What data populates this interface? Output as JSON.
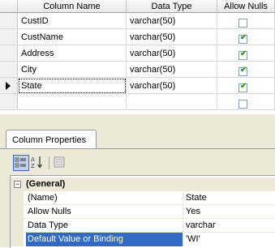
{
  "grid": {
    "headers": {
      "column_name": "Column Name",
      "data_type": "Data Type",
      "allow_nulls": "Allow Nulls"
    },
    "rows": [
      {
        "name": "CustID",
        "type": "varchar(50)",
        "allow_nulls": false
      },
      {
        "name": "CustName",
        "type": "varchar(50)",
        "allow_nulls": true
      },
      {
        "name": "Address",
        "type": "varchar(50)",
        "allow_nulls": true
      },
      {
        "name": "City",
        "type": "varchar(50)",
        "allow_nulls": true
      },
      {
        "name": "State",
        "type": "varchar(50)",
        "allow_nulls": true,
        "selected": true
      },
      {
        "name": "",
        "type": "",
        "allow_nulls": false
      }
    ]
  },
  "panel": {
    "tab_label": "Column Properties",
    "toolbar": {
      "categorized_icon": "categorized-icon",
      "alphabetical_icon": "sort-az-icon",
      "pages_icon": "property-pages-icon"
    },
    "category": "(General)",
    "properties": [
      {
        "name": "(Name)",
        "value": "State"
      },
      {
        "name": "Allow Nulls",
        "value": "Yes"
      },
      {
        "name": "Data Type",
        "value": "varchar"
      },
      {
        "name": "Default Value or Binding",
        "value": "'WI'",
        "selected": true
      }
    ]
  },
  "colors": {
    "selection": "#316ac5",
    "panel": "#ece9d8",
    "checkmark": "#21a121"
  }
}
